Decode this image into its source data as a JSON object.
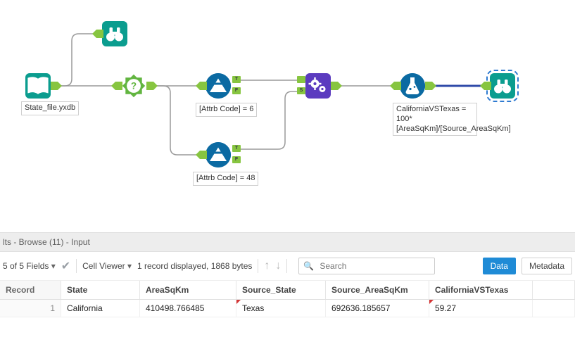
{
  "canvas": {
    "nodes": {
      "input": {
        "label": "State_file.yxdb"
      },
      "filter1": {
        "label": "[Attrb Code] = 6",
        "true": "T",
        "false": "F"
      },
      "filter2": {
        "label": "[Attrb Code] = 48",
        "true": "T",
        "false": "F"
      },
      "formula": {
        "label": "CaliforniaVSTexas = 100* [AreaSqKm]/[Source_AreaSqKm]"
      },
      "join": {
        "s_label": "S"
      }
    }
  },
  "results": {
    "title": "lts - Browse (11) - Input",
    "fields_summary": "5 of 5 Fields",
    "cell_viewer": "Cell Viewer",
    "record_summary": "1 record displayed, 1868 bytes",
    "search_placeholder": "Search",
    "buttons": {
      "data": "Data",
      "metadata": "Metadata"
    },
    "columns": [
      "Record",
      "State",
      "AreaSqKm",
      "Source_State",
      "Source_AreaSqKm",
      "CaliforniaVSTexas"
    ],
    "rows": [
      {
        "Record": "1",
        "State": "California",
        "AreaSqKm": "410498.766485",
        "Source_State": "Texas",
        "Source_AreaSqKm": "692636.185657",
        "CaliforniaVSTexas": "59.27"
      }
    ]
  }
}
